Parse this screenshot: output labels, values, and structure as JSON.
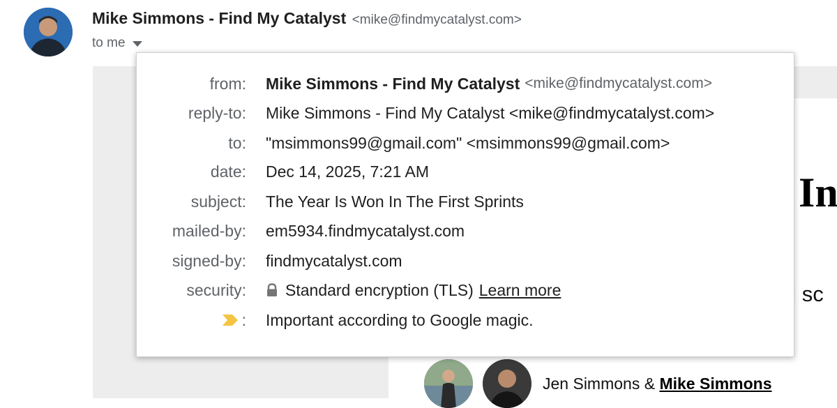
{
  "header": {
    "sender_name": "Mike Simmons - Find My Catalyst",
    "sender_email": "<mike@findmycatalyst.com>",
    "to_text": "to me"
  },
  "background": {
    "heading_fragment": "In",
    "text_fragment": "id sc",
    "author_first": "Jen Simmons &",
    "author_link": "Mike Simmons"
  },
  "details": {
    "from": {
      "label": "from:",
      "name": "Mike Simmons - Find My Catalyst",
      "email": "<mike@findmycatalyst.com>"
    },
    "reply_to": {
      "label": "reply-to:",
      "value": "Mike Simmons - Find My Catalyst <mike@findmycatalyst.com>"
    },
    "to": {
      "label": "to:",
      "value": "\"msimmons99@gmail.com\" <msimmons99@gmail.com>"
    },
    "date": {
      "label": "date:",
      "value": "Dec 14, 2025, 7:21 AM"
    },
    "subject": {
      "label": "subject:",
      "value": "The Year Is Won In The First Sprints"
    },
    "mailed_by": {
      "label": "mailed-by:",
      "value": "em5934.findmycatalyst.com"
    },
    "signed_by": {
      "label": "signed-by:",
      "value": "findmycatalyst.com"
    },
    "security": {
      "label": "security:",
      "value": "Standard encryption (TLS)",
      "link": "Learn more"
    },
    "importance": {
      "label_colon": ":",
      "value": "Important according to Google magic."
    }
  },
  "colors": {
    "importance_marker": "#f4c542",
    "label_gray": "#5f6368",
    "body_gray": "#ededed"
  },
  "icons": [
    "avatar",
    "caret-down-icon",
    "lock-icon",
    "importance-marker-icon"
  ]
}
